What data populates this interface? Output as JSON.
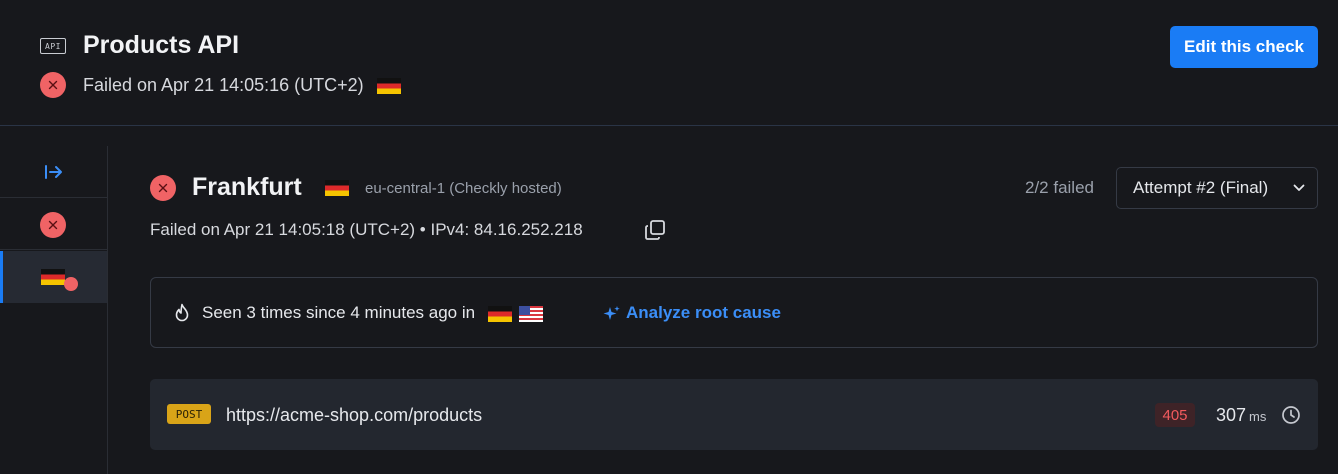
{
  "header": {
    "api_badge": "API",
    "title": "Products API",
    "status_text": "Failed on Apr 21 14:05:16 (UTC+2)",
    "edit_button": "Edit this check"
  },
  "run": {
    "location": "Frankfurt",
    "region": "eu-central-1 (Checkly hosted)",
    "attempts_summary": "2/2 failed",
    "attempt_selected": "Attempt #2 (Final)",
    "details": "Failed on Apr 21 14:05:18 (UTC+2) • IPv4: 84.16.252.218"
  },
  "insight": {
    "text": "Seen 3 times since 4 minutes ago in",
    "analyze_label": "Analyze root cause"
  },
  "request": {
    "method": "POST",
    "url": "https://acme-shop.com/products",
    "status_code": "405",
    "duration": "307",
    "duration_unit": "ms"
  },
  "colors": {
    "accent": "#1a7cf5",
    "failure": "#f06365",
    "method_post": "#d9a418",
    "background": "#17181c"
  },
  "icons": [
    "api-icon",
    "fail-icon",
    "germany-flag",
    "us-flag",
    "expand-panel-icon",
    "copy-icon",
    "flame-icon",
    "sparkle-icon",
    "chevron-down-icon",
    "clock-icon"
  ]
}
